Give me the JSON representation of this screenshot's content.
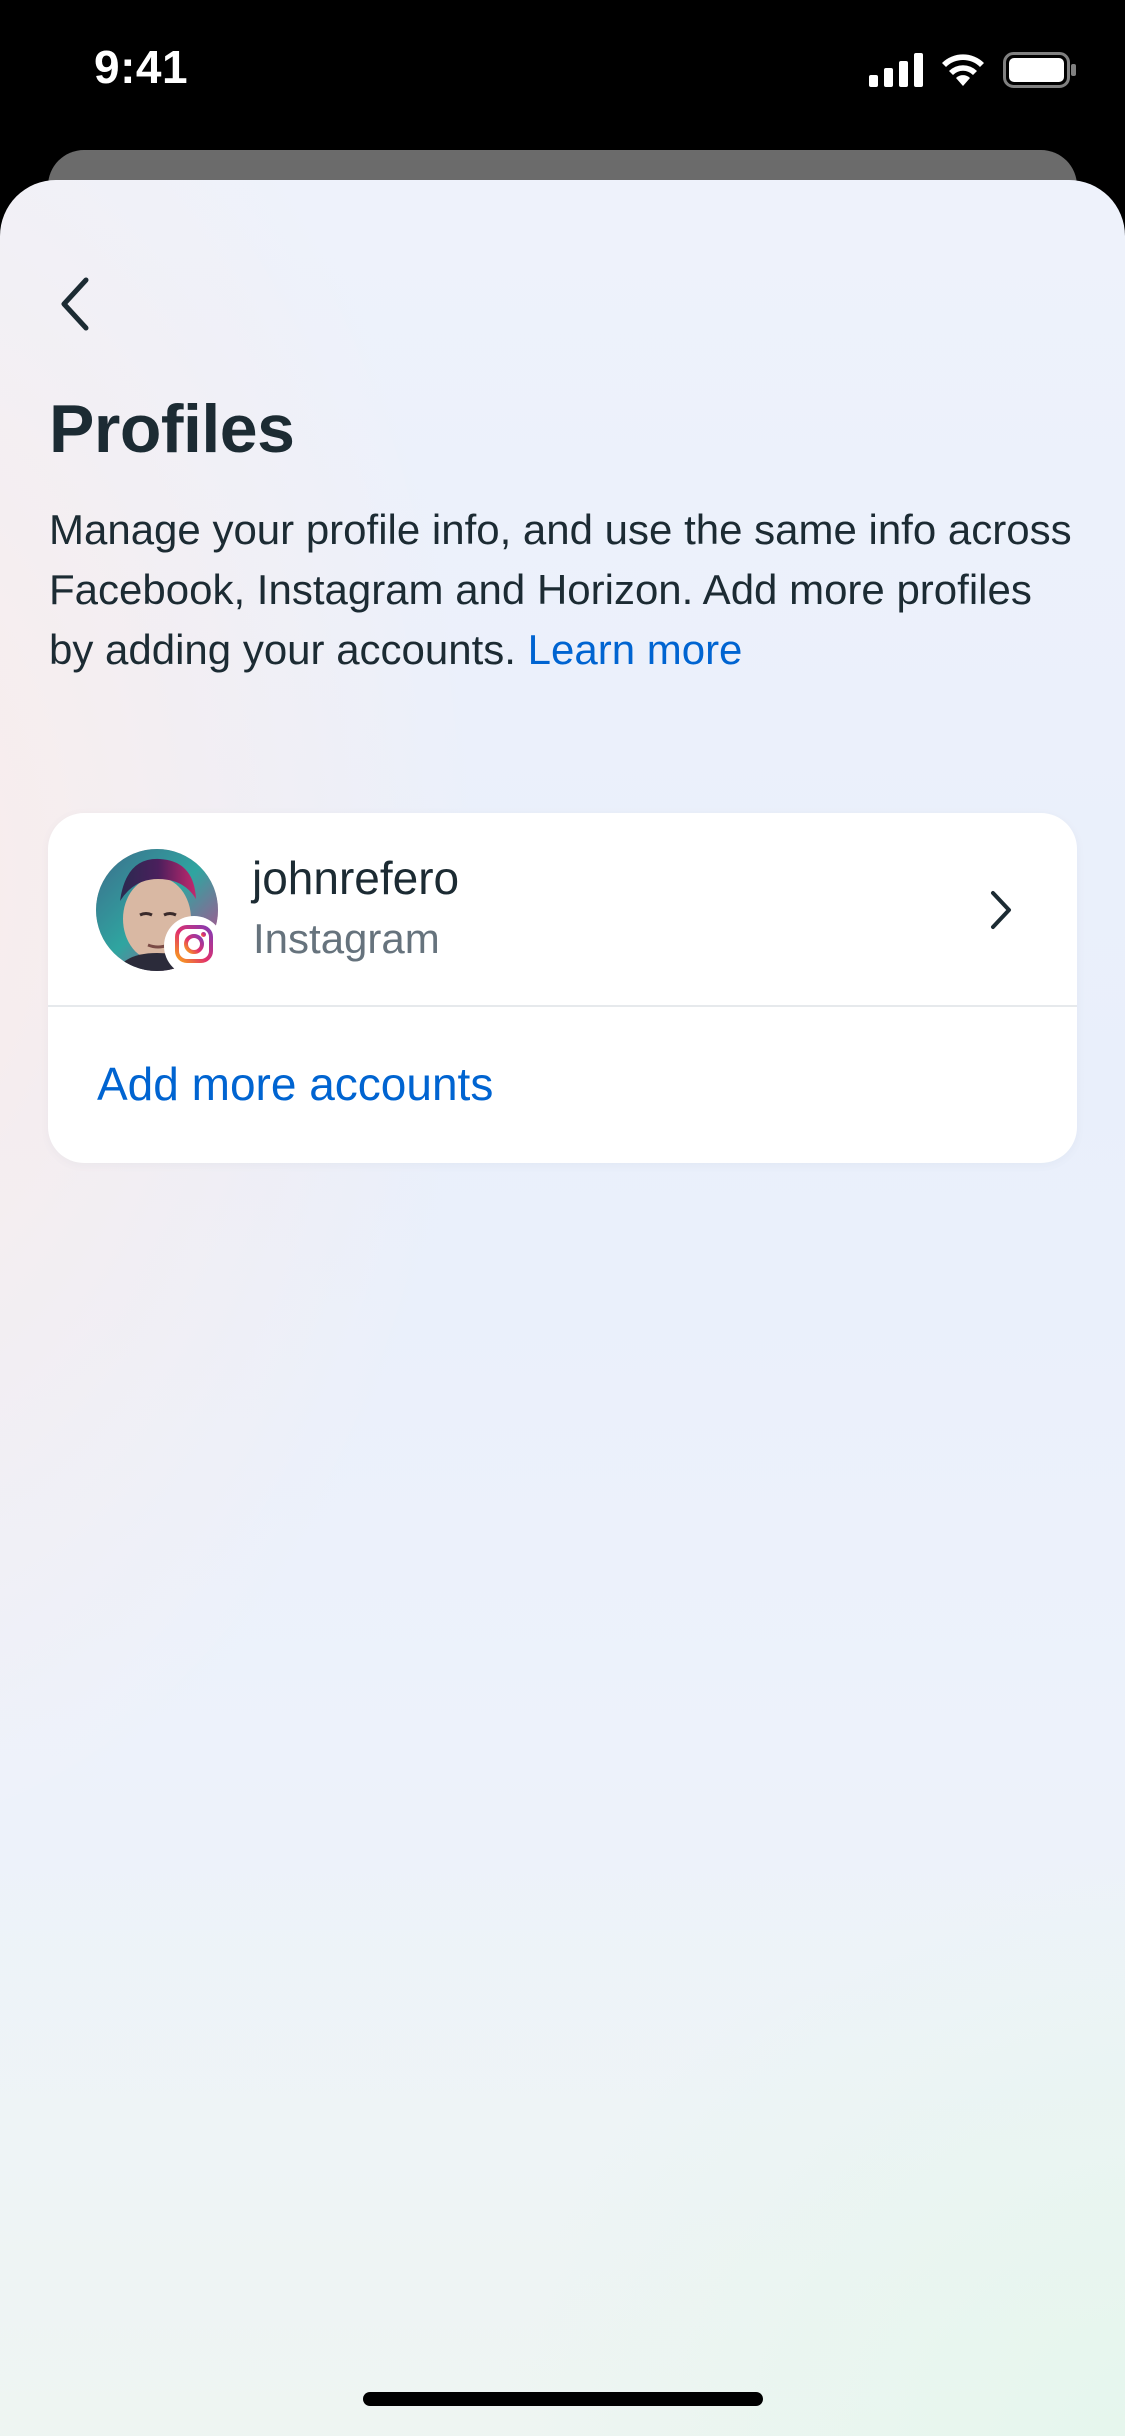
{
  "status_bar": {
    "time": "9:41"
  },
  "header": {
    "title": "Profiles",
    "description": "Manage your profile info, and use the same info across Facebook, Instagram and Horizon. Add more profiles by adding your accounts.",
    "learn_more_label": "Learn more"
  },
  "accounts": [
    {
      "username": "johnrefero",
      "platform": "Instagram",
      "avatar_icon": "profile-photo",
      "badge_icon": "instagram-icon"
    }
  ],
  "actions": {
    "add_more_label": "Add more accounts"
  },
  "colors": {
    "link": "#0064d1",
    "text_primary": "#1c2b33",
    "text_secondary": "#66737d"
  }
}
